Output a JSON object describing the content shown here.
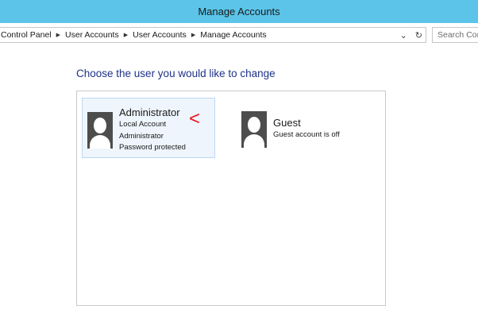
{
  "window": {
    "title": "Manage Accounts"
  },
  "address": {
    "breadcrumb": [
      "Control Panel",
      "User Accounts",
      "User Accounts",
      "Manage Accounts"
    ],
    "dropdown_glyph": "⌄",
    "refresh_glyph": "↻"
  },
  "search": {
    "placeholder": "Search Control Panel"
  },
  "main": {
    "heading": "Choose the user you would like to change"
  },
  "accounts": [
    {
      "name": "Administrator",
      "details": [
        "Local Account",
        "Administrator",
        "Password protected"
      ],
      "icon": "user-avatar-icon",
      "selected": true
    },
    {
      "name": "Guest",
      "details": [
        "Guest account is off"
      ],
      "icon": "user-avatar-icon",
      "selected": false
    }
  ],
  "annotation": {
    "text": "<",
    "color": "#e8141b"
  },
  "colors": {
    "titlebar": "#5bc4e8",
    "heading": "#1e3287",
    "selected_bg": "#eef5fc"
  }
}
